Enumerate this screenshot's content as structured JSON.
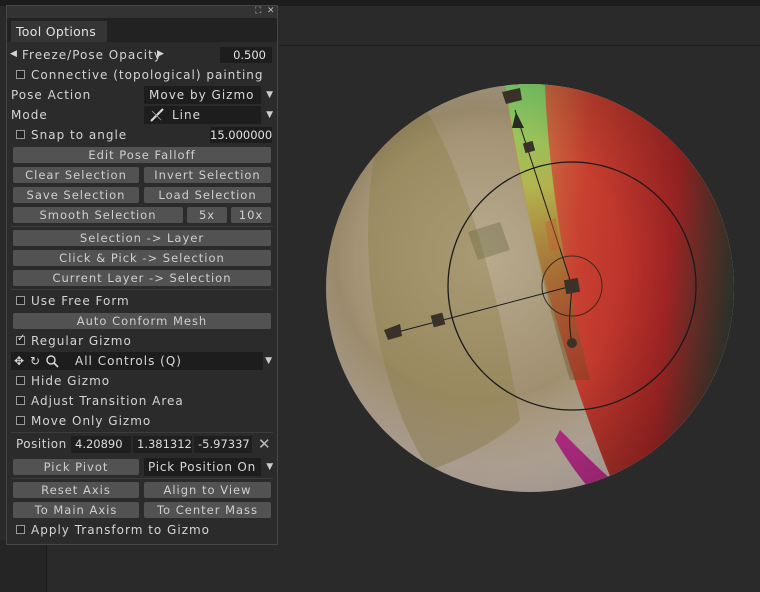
{
  "panel": {
    "tab": "Tool Options",
    "freeze_label": "Freeze/Pose Opacity",
    "freeze_value": "0.500",
    "connective_label": "Connective (topological) painting",
    "pose_action_label": "Pose Action",
    "pose_action_value": "Move by Gizmo",
    "mode_label": "Mode",
    "mode_value": "Line",
    "snap_label": "Snap to angle",
    "snap_value": "15.000000",
    "edit_pose_falloff": "Edit Pose Falloff",
    "clear_selection": "Clear Selection",
    "invert_selection": "Invert Selection",
    "save_selection": "Save Selection",
    "load_selection": "Load Selection",
    "smooth_selection": "Smooth Selection",
    "x5": "5x",
    "x10": "10x",
    "selection_to_layer": "Selection -> Layer",
    "click_pick": "Click & Pick -> Selection",
    "current_layer": "Current Layer -> Selection",
    "use_free_form": "Use Free Form",
    "auto_conform": "Auto Conform Mesh",
    "regular_gizmo": "Regular Gizmo",
    "controls_value": "All Controls (Q)",
    "hide_gizmo": "Hide Gizmo",
    "adjust_transition": "Adjust Transition Area",
    "move_only_gizmo": "Move Only Gizmo",
    "position_label": "Position",
    "pos_x": "4.20890",
    "pos_y": "1.381312",
    "pos_z": "-5.97337",
    "pick_pivot": "Pick Pivot",
    "pick_position": "Pick Position On",
    "reset_axis": "Reset Axis",
    "align_view": "Align to View",
    "to_main_axis": "To Main Axis",
    "to_center_mass": "To Center Mass",
    "apply_transform": "Apply Transform to Gizmo"
  },
  "icons": {
    "pin": "pin-icon",
    "close": "close-icon",
    "move": "move-icon",
    "rotate": "rotate-icon",
    "scale": "scale-icon"
  },
  "checks": {
    "connective": false,
    "snap": false,
    "use_free_form": false,
    "regular_gizmo": true,
    "hide_gizmo": false,
    "adjust_transition": false,
    "move_only_gizmo": false,
    "apply_transform": false
  },
  "colors": {
    "panel_bg": "#2b2b2b",
    "button_bg": "#525252",
    "field_bg": "#1d1d1d",
    "viewport_bg": "#2a2a2a"
  }
}
